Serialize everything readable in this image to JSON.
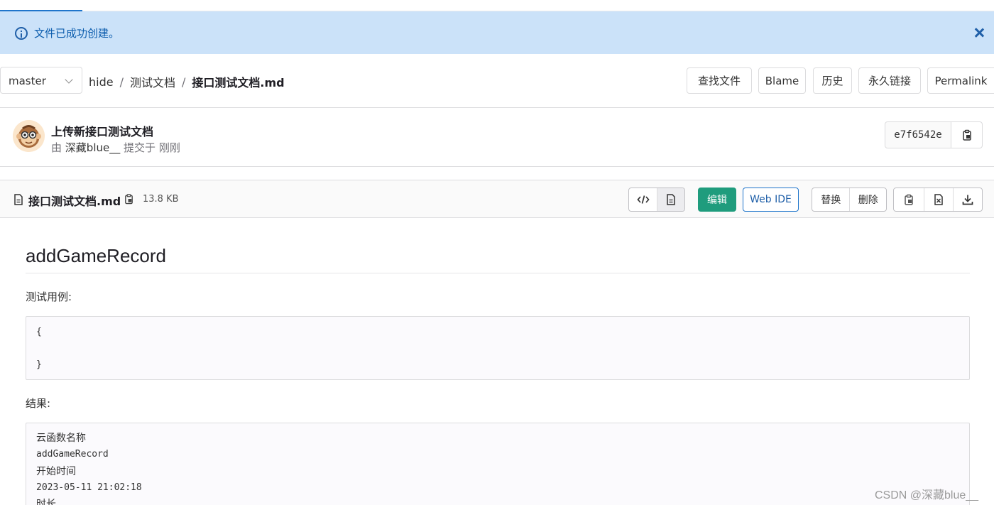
{
  "flash": {
    "message": "文件已成功创建。"
  },
  "nav": {
    "branch": "master",
    "breadcrumb": [
      "hide",
      "测试文档",
      "接口测试文档.md"
    ],
    "separator": "/",
    "buttons": [
      "查找文件",
      "Blame",
      "历史",
      "永久链接",
      "Permalink"
    ]
  },
  "commit": {
    "title": "上传新接口测试文档",
    "by_prefix": "由",
    "author": "深藏blue__",
    "action": "提交于",
    "time": "刚刚",
    "sha": "e7f6542e"
  },
  "file": {
    "name": "接口测试文档.md",
    "size": "13.8 KB",
    "edit_label": "编辑",
    "webide_label": "Web IDE",
    "replace_label": "替换",
    "delete_label": "删除"
  },
  "content": {
    "heading": "addGameRecord",
    "test_case_label": "测试用例:",
    "test_case_lines": [
      "{",
      "",
      "}"
    ],
    "result_label": "结果:",
    "result_lines": [
      "云函数名称",
      "addGameRecord",
      "开始时间",
      "2023-05-11 21:02:18",
      "时长"
    ]
  },
  "watermark": "CSDN @深藏blue__",
  "colors": {
    "flash_bg": "#cbe2f9",
    "flash_text": "#0b5cad",
    "edit_button": "#1f9c7d",
    "link_blue": "#1f75cb"
  }
}
